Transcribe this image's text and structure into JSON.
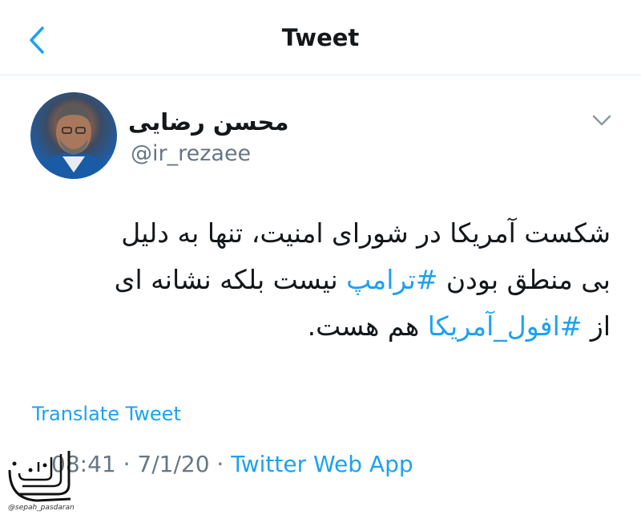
{
  "header": {
    "title": "Tweet",
    "back_icon": "chevron-left-icon"
  },
  "tweet": {
    "author_name": "محسن رضایی",
    "handle": "@ir_rezaee",
    "text_lines": [
      {
        "before": "شکست آمریکا در شورای امنیت، تنها به دلیل",
        "tag": "",
        "after": ""
      },
      {
        "before": "بی منطق بودن ",
        "tag": "#ترامپ",
        "after": " نیست بلکه نشانه ای"
      },
      {
        "before": "از ",
        "tag": "#افول_آمریکا",
        "after": " هم هست."
      }
    ],
    "translate_label": "Translate Tweet",
    "time": "08:41",
    "date": "7/1/20",
    "separator": " · ",
    "source": "Twitter Web App"
  },
  "watermark": {
    "caption": "@sepah_pasdaran"
  },
  "colors": {
    "link": "#1da1f2",
    "secondary": "#657786",
    "text": "#14171a"
  }
}
